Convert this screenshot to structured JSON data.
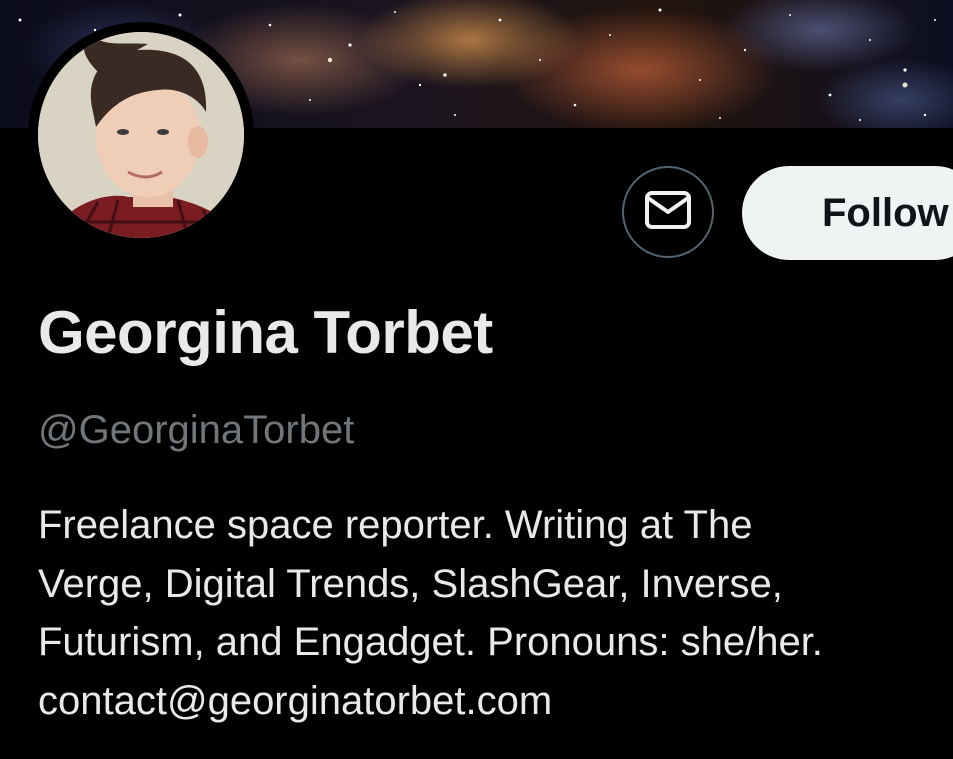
{
  "profile": {
    "display_name": "Georgina Torbet",
    "handle": "@GeorginaTorbet",
    "bio_lines": [
      "Freelance space reporter. Writing at The",
      "Verge, Digital Trends, SlashGear, Inverse,",
      "Futurism, and Engadget. Pronouns: she/her.",
      "contact@georginatorbet.com"
    ]
  },
  "actions": {
    "message_icon": "envelope-icon",
    "follow_label": "Follow"
  },
  "colors": {
    "background": "#000000",
    "primary_text": "#e7e9ea",
    "secondary_text": "#71767b",
    "follow_button_bg": "#eff3f4",
    "follow_button_text": "#0f1419",
    "icon_border": "#536471"
  }
}
